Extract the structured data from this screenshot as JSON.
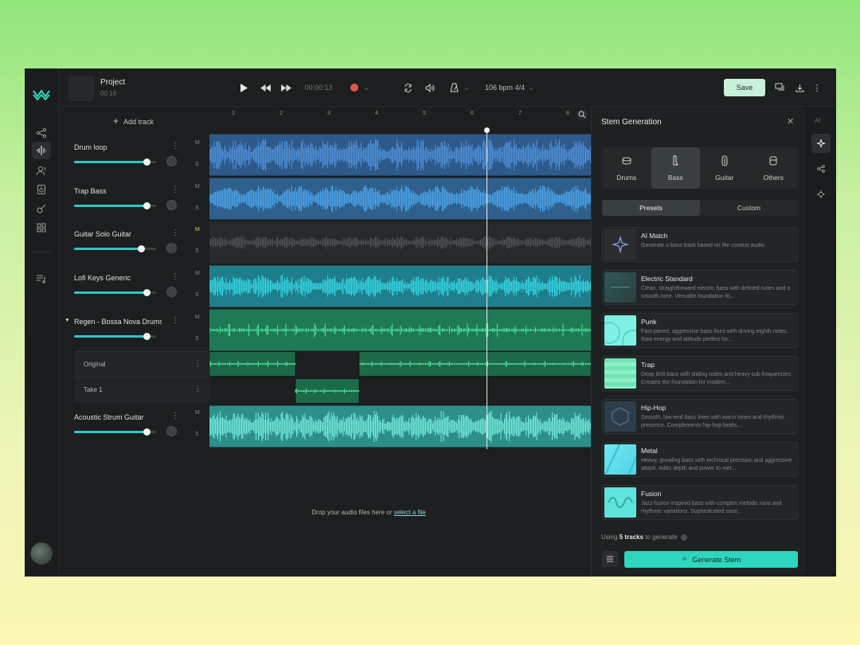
{
  "project": {
    "name": "Project",
    "duration": "00:18"
  },
  "transport": {
    "time": "00:00:13",
    "bpm": "106 bpm 4/4"
  },
  "toolbar": {
    "save_label": "Save"
  },
  "tracks_panel": {
    "add_track_label": "Add track",
    "tracks": [
      {
        "name": "Drum loop",
        "volume": 0.9
      },
      {
        "name": "Trap Bass",
        "volume": 0.9
      },
      {
        "name": "Guitar Solo Guitar",
        "volume": 0.83
      },
      {
        "name": "Lofi Keys Generic",
        "volume": 0.9
      },
      {
        "name": "Regen - Bossa Nova Drums",
        "volume": 0.9
      },
      {
        "name": "Acoustic Strum Guitar",
        "volume": 0.9
      }
    ],
    "takes": [
      "Original",
      "Take 1"
    ],
    "mute_label": "M",
    "solo_label": "S"
  },
  "ruler": [
    "1",
    "2",
    "3",
    "4",
    "5",
    "6",
    "7",
    "8"
  ],
  "drop_zone": {
    "text": "Drop your audio files here or",
    "link": "select a file"
  },
  "panel": {
    "title": "Stem Generation",
    "stem_types": [
      "Drums",
      "Bass",
      "Guitar",
      "Others"
    ],
    "active_stem": "Bass",
    "tabs": [
      "Presets",
      "Custom"
    ],
    "presets": [
      {
        "name": "AI Match",
        "desc": "Generate a bass track based on the context audio"
      },
      {
        "name": "Electric Standard",
        "desc": "Clean, straightforward electric bass with defined notes and a smooth tone. Versatile foundation fo..."
      },
      {
        "name": "Punk",
        "desc": "Fast-paced, aggressive bass lines with driving eighth notes. Raw energy and attitude perfect for..."
      },
      {
        "name": "Trap",
        "desc": "Deep 808 bass with sliding notes and heavy sub frequencies. Creates the foundation for modern..."
      },
      {
        "name": "Hip-Hop",
        "desc": "Smooth, low-end bass lines with warm tones and rhythmic presence. Complements hip-hop beats..."
      },
      {
        "name": "Metal",
        "desc": "Heavy, growling bass with technical precision and aggressive attack. Adds depth and power to met..."
      },
      {
        "name": "Fusion",
        "desc": "Jazz-fusion inspired bass with complex melodic runs and rhythmic variations. Sophisticated soun..."
      }
    ],
    "footer_prefix": "Using",
    "footer_count": "5 tracks",
    "footer_suffix": "to generate",
    "generate_label": "Generate Stem"
  },
  "right_rail": {
    "ai_label": "AI"
  },
  "colors": {
    "accent": "#2fd6be",
    "drum": "#4f8fd6",
    "bass": "#3f8fd0",
    "keys": "#2bbccd",
    "bossa": "#2aa876",
    "acoustic": "#57cfc4"
  }
}
